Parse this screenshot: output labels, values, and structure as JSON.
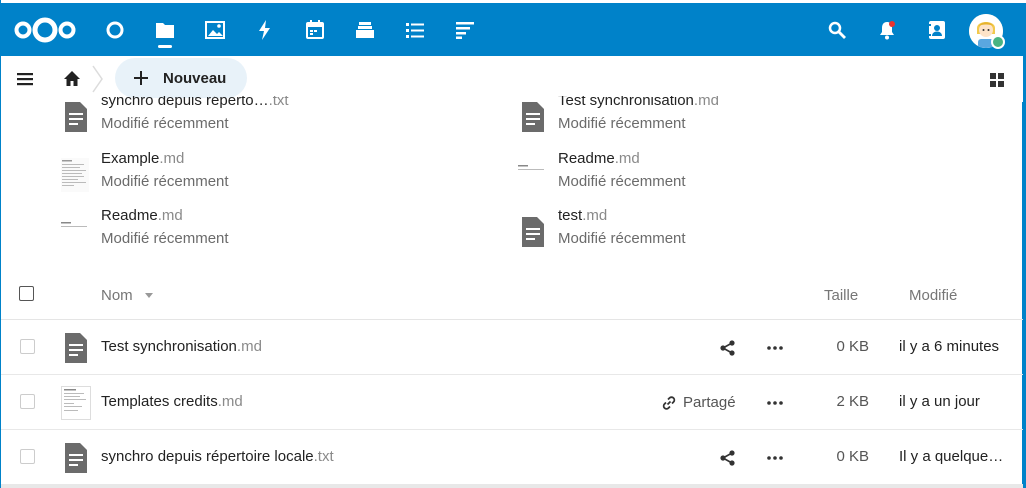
{
  "header": {
    "brand_color": "#0082c9",
    "apps": [
      {
        "name": "dashboard",
        "icon": "circle-icon"
      },
      {
        "name": "files",
        "icon": "folder-icon",
        "active": true
      },
      {
        "name": "photos",
        "icon": "image-icon"
      },
      {
        "name": "activity",
        "icon": "lightning-icon"
      },
      {
        "name": "calendar",
        "icon": "calendar-icon"
      },
      {
        "name": "deck",
        "icon": "stack-icon"
      },
      {
        "name": "tasks",
        "icon": "checklist-icon"
      },
      {
        "name": "notes",
        "icon": "notes-icon"
      }
    ]
  },
  "toolbar": {
    "new_label": "Nouveau"
  },
  "recent": [
    {
      "base": "synchro depuis réperto…",
      "ext": ".txt",
      "sub": "Modifié récemment",
      "thumb": "text"
    },
    {
      "base": "Test synchronisation",
      "ext": ".md",
      "sub": "Modifié récemment",
      "thumb": "text"
    },
    {
      "base": "Example",
      "ext": ".md",
      "sub": "Modifié récemment",
      "thumb": "doc-preview"
    },
    {
      "base": "Readme",
      "ext": ".md",
      "sub": "Modifié récemment",
      "thumb": "line-preview"
    },
    {
      "base": "Readme",
      "ext": ".md",
      "sub": "Modifié récemment",
      "thumb": "line-preview"
    },
    {
      "base": "test",
      "ext": ".md",
      "sub": "Modifié récemment",
      "thumb": "text"
    }
  ],
  "table": {
    "col_name": "Nom",
    "col_size": "Taille",
    "col_modified": "Modifié",
    "rows": [
      {
        "base": "Test synchronisation",
        "ext": ".md",
        "size": "0 KB",
        "modified": "il y a 6 minutes",
        "shared": false,
        "thumb": "text"
      },
      {
        "base": "Templates credits",
        "ext": ".md",
        "size": "2 KB",
        "modified": "il y a un jour",
        "shared": true,
        "shared_label": "Partagé",
        "thumb": "doc-preview"
      },
      {
        "base": "synchro depuis répertoire locale",
        "ext": ".txt",
        "size": "0 KB",
        "modified": "Il y a quelque…",
        "shared": false,
        "thumb": "text"
      }
    ]
  }
}
